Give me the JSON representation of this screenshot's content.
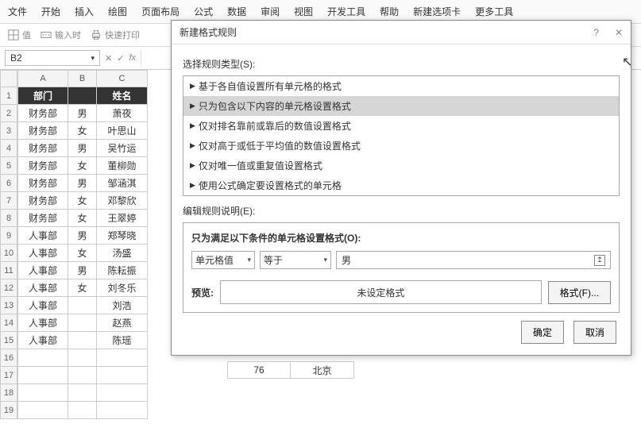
{
  "menu": [
    "文件",
    "开始",
    "插入",
    "绘图",
    "页面布局",
    "公式",
    "数据",
    "审阅",
    "视图",
    "开发工具",
    "帮助",
    "新建选项卡",
    "更多工具"
  ],
  "toolbar": {
    "v": "值",
    "i": "输入时",
    "q": "快速打印"
  },
  "namebox": "B2",
  "colHeaders": [
    "A",
    "B",
    "C"
  ],
  "headerRow": [
    "部门",
    "",
    "姓名"
  ],
  "rows": [
    [
      "财务部",
      "男",
      "萧夜"
    ],
    [
      "财务部",
      "女",
      "叶思山"
    ],
    [
      "财务部",
      "男",
      "吴竹运"
    ],
    [
      "财务部",
      "女",
      "董柳勋"
    ],
    [
      "财务部",
      "男",
      "邹涵淇"
    ],
    [
      "财务部",
      "女",
      "邓黎欣"
    ],
    [
      "财务部",
      "女",
      "王翠婷"
    ],
    [
      "人事部",
      "男",
      "郑琴晓"
    ],
    [
      "人事部",
      "女",
      "汤盛"
    ],
    [
      "人事部",
      "男",
      "陈耘振"
    ],
    [
      "人事部",
      "女",
      "刘冬乐"
    ],
    [
      "人事部",
      "",
      "刘浩"
    ],
    [
      "人事部",
      "",
      "赵燕"
    ],
    [
      "人事部",
      "",
      "陈瑶"
    ]
  ],
  "extra": {
    "val": "76",
    "city": "北京"
  },
  "dialog": {
    "title": "新建格式规则",
    "sel_type": "选择规则类型(S):",
    "types": [
      "基于各自值设置所有单元格的格式",
      "只为包含以下内容的单元格设置格式",
      "仅对排名靠前或靠后的数值设置格式",
      "仅对高于或低于平均值的数值设置格式",
      "仅对唯一值或重复值设置格式",
      "使用公式确定要设置格式的单元格"
    ],
    "edit_desc": "编辑规则说明(E):",
    "cond_title": "只为满足以下条件的单元格设置格式(O):",
    "combo1": "单元格值",
    "combo2": "等于",
    "cond_value": "男",
    "preview_label": "预览:",
    "preview_text": "未设定格式",
    "format_btn": "格式(F)...",
    "ok": "确定",
    "cancel": "取消"
  }
}
